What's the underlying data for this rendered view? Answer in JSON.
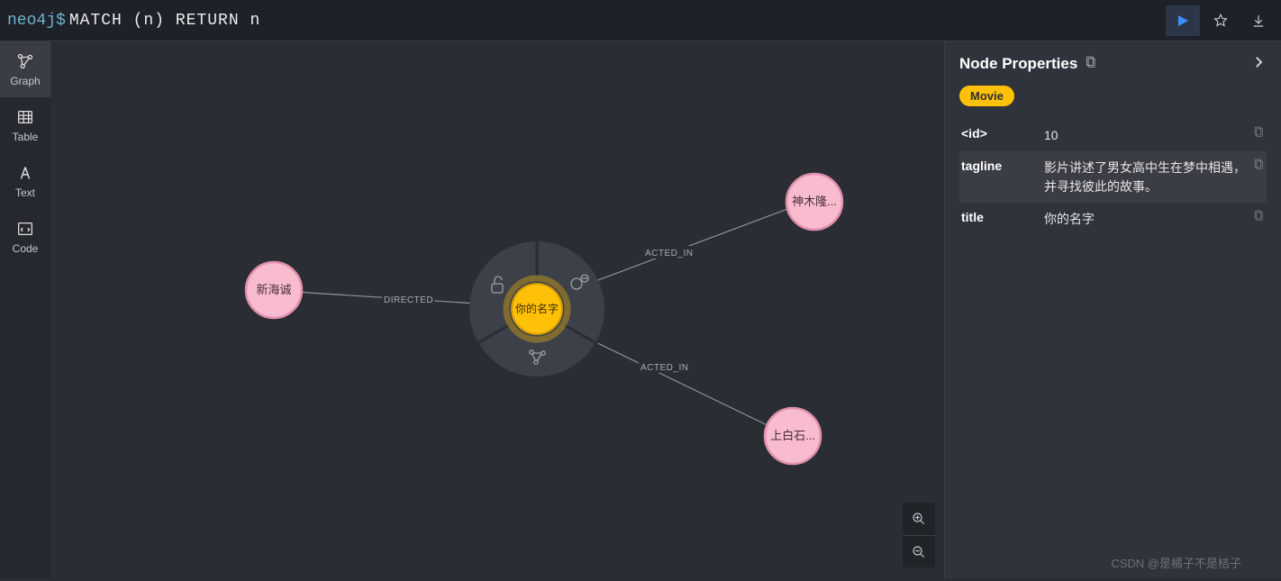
{
  "prompt": "neo4j$",
  "query": "MATCH (n) RETURN n",
  "leftTabs": [
    {
      "label": "Graph",
      "icon": "graph"
    },
    {
      "label": "Table",
      "icon": "table"
    },
    {
      "label": "Text",
      "icon": "text"
    },
    {
      "label": "Code",
      "icon": "code"
    }
  ],
  "panel": {
    "title": "Node Properties",
    "label": "Movie",
    "props": {
      "id_key": "<id>",
      "id_val": "10",
      "tagline_key": "tagline",
      "tagline_val": "影片讲述了男女高中生在梦中相遇，并寻找彼此的故事。",
      "title_key": "title",
      "title_val": "你的名字"
    }
  },
  "graph": {
    "center": {
      "label": "你的名字"
    },
    "peers": [
      {
        "label": "新海诚",
        "rel": "DIRECTED"
      },
      {
        "label": "神木隆...",
        "rel": "ACTED_IN"
      },
      {
        "label": "上白石...",
        "rel": "ACTED_IN"
      }
    ]
  },
  "watermark": "CSDN @是橘子不是桔子"
}
